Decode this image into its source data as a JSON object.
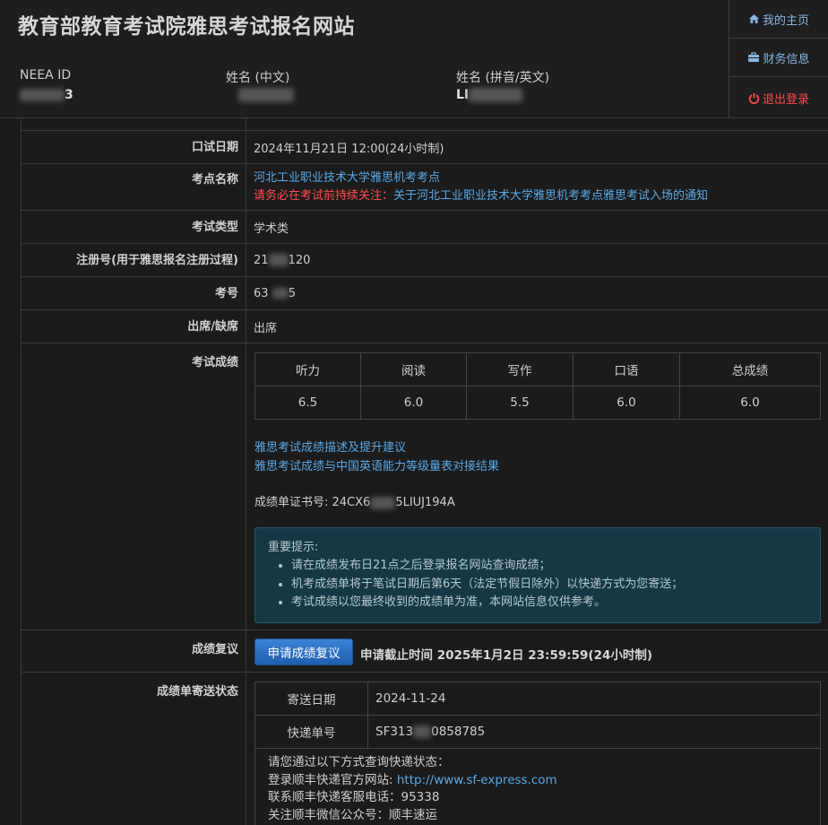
{
  "header": {
    "site_title": "教育部教育考试院雅思考试报名网站",
    "neea_label": "NEEA ID",
    "neea_value_suffix": "3",
    "name_cn_label": "姓名 (中文)",
    "name_en_label": "姓名 (拼音/英文)",
    "name_en_value_prefix": "LI"
  },
  "nav": {
    "home": "我的主页",
    "finance": "财务信息",
    "logout": "退出登录"
  },
  "rows": {
    "oral_date_label": "口试日期",
    "oral_date_value": "2024年11月21日 12:00(24小时制)",
    "center_label": "考点名称",
    "center_value": "河北工业职业技术大学雅思机考考点",
    "center_warn": "请务必在考试前持续关注：",
    "center_notice_link": "关于河北工业职业技术大学雅思机考考点雅思考试入场的通知",
    "exam_type_label": "考试类型",
    "exam_type_value": "学术类",
    "reg_label": "注册号(用于雅思报名注册过程)",
    "reg_prefix": "21",
    "reg_suffix": "120",
    "exam_no_label": "考号",
    "exam_no_prefix": "63",
    "exam_no_suffix": "5",
    "attendance_label": "出席/缺席",
    "attendance_value": "出席",
    "score_label": "考试成绩",
    "review_label": "成绩复议",
    "delivery_label": "成绩单寄送状态"
  },
  "scores": {
    "headers": [
      "听力",
      "阅读",
      "写作",
      "口语",
      "总成绩"
    ],
    "values": [
      "6.5",
      "6.0",
      "5.5",
      "6.0",
      "6.0"
    ]
  },
  "score_links": {
    "desc": "雅思考试成绩描述及提升建议",
    "cse": "雅思考试成绩与中国英语能力等级量表对接结果"
  },
  "trf": {
    "label": "成绩单证书号: 24CX6",
    "suffix": "5LIUJ194A"
  },
  "notice": {
    "title": "重要提示:",
    "items": [
      "请在成绩发布日21点之后登录报名网站查询成绩；",
      "机考成绩单将于笔试日期后第6天（法定节假日除外）以快递方式为您寄送；",
      "考试成绩以您最终收到的成绩单为准，本网站信息仅供参考。"
    ]
  },
  "review": {
    "button": "申请成绩复议",
    "deadline": "申请截止时间 2025年1月2日 23:59:59(24小时制)"
  },
  "delivery": {
    "date_label": "寄送日期",
    "date_value": "2024-11-24",
    "tracking_label": "快递单号",
    "tracking_prefix": "SF313",
    "tracking_suffix": "0858785",
    "query_intro": "请您通过以下方式查询快递状态：",
    "site_label": "登录顺丰快递官方网站:",
    "site_link": "http://www.sf-express.com",
    "phone_label": "联系顺丰快递客服电话：",
    "phone_value": "95338",
    "wechat_label": "关注顺丰微信公众号：",
    "wechat_value": "顺丰速运"
  },
  "colors": {
    "link": "#5aa9e6",
    "warn": "#ff4d4d",
    "logout": "#ff4a4a",
    "notice_bg": "#163846",
    "button": "#2b6fc4"
  }
}
